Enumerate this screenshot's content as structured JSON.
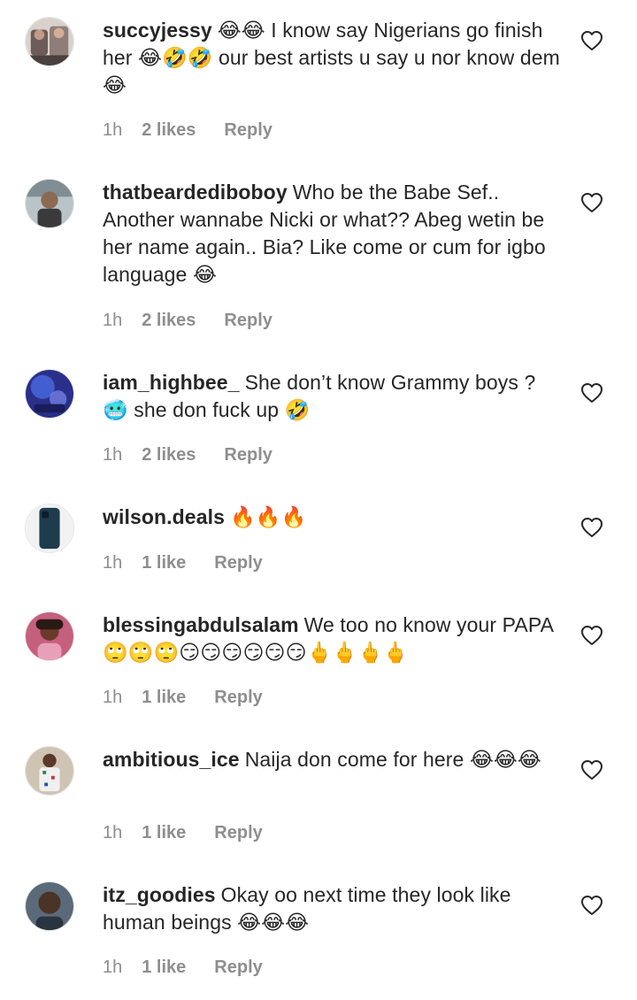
{
  "comments": [
    {
      "username": "succyjessy",
      "text": "😂😂 I know say Nigerians go finish her 😂🤣🤣 our best artists u say u nor know dem 😂",
      "time": "1h",
      "likes": "2 likes",
      "reply": "Reply",
      "avatar_color": "#7a6a68"
    },
    {
      "username": "thatbeardediboboy",
      "text": "Who be the Babe Sef.. Another wannabe Nicki or what?? Abeg wetin be her name again.. Bia? Like come or cum for igbo language 😂",
      "time": "1h",
      "likes": "2 likes",
      "reply": "Reply",
      "avatar_color": "#8a9aa0"
    },
    {
      "username": "iam_highbee_",
      "text": "She don’t know Grammy boys ? 🥶 she don fuck up 🤣",
      "time": "1h",
      "likes": "2 likes",
      "reply": "Reply",
      "avatar_color": "#3a4ab8"
    },
    {
      "username": "wilson.deals",
      "text": "🔥🔥🔥",
      "time": "1h",
      "likes": "1 like",
      "reply": "Reply",
      "avatar_color": "#1d3a4a"
    },
    {
      "username": "blessingabdulsalam",
      "text": "We too no know your PAPA 🙄🙄🙄😏😏😏😏😏😏🖕🖕🖕🖕",
      "time": "1h",
      "likes": "1 like",
      "reply": "Reply",
      "avatar_color": "#b04a78"
    },
    {
      "username": "ambitious_ice",
      "text": "Naija don come for here 😂😂😂",
      "time": "1h",
      "likes": "1 like",
      "reply": "Reply",
      "avatar_color": "#7a6a5a"
    },
    {
      "username": "itz_goodies",
      "text": "Okay oo next time they look like human beings 😂😂😂",
      "time": "1h",
      "likes": "1 like",
      "reply": "Reply",
      "avatar_color": "#4a5a68"
    }
  ]
}
